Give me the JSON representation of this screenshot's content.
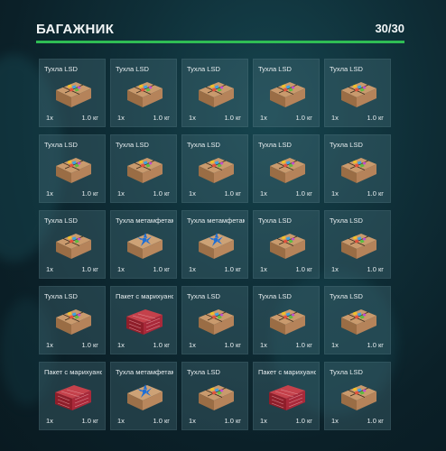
{
  "header": {
    "title": "БАГАЖНИК",
    "capacity": "30/30"
  },
  "colors": {
    "accent": "#2fbd54"
  },
  "slots": [
    {
      "name": "Тухла LSD",
      "qty": "1x",
      "weight": "1.0 кг",
      "icon": "lsd-package-icon"
    },
    {
      "name": "Тухла LSD",
      "qty": "1x",
      "weight": "1.0 кг",
      "icon": "lsd-package-icon"
    },
    {
      "name": "Тухла LSD",
      "qty": "1x",
      "weight": "1.0 кг",
      "icon": "lsd-package-icon"
    },
    {
      "name": "Тухла LSD",
      "qty": "1x",
      "weight": "1.0 кг",
      "icon": "lsd-package-icon"
    },
    {
      "name": "Тухла LSD",
      "qty": "1x",
      "weight": "1.0 кг",
      "icon": "lsd-package-icon"
    },
    {
      "name": "Тухла LSD",
      "qty": "1x",
      "weight": "1.0 кг",
      "icon": "lsd-package-icon"
    },
    {
      "name": "Тухла LSD",
      "qty": "1x",
      "weight": "1.0 кг",
      "icon": "lsd-package-icon"
    },
    {
      "name": "Тухла LSD",
      "qty": "1x",
      "weight": "1.0 кг",
      "icon": "lsd-package-icon"
    },
    {
      "name": "Тухла LSD",
      "qty": "1x",
      "weight": "1.0 кг",
      "icon": "lsd-package-icon"
    },
    {
      "name": "Тухла LSD",
      "qty": "1x",
      "weight": "1.0 кг",
      "icon": "lsd-package-icon"
    },
    {
      "name": "Тухла LSD",
      "qty": "1x",
      "weight": "1.0 кг",
      "icon": "lsd-package-icon"
    },
    {
      "name": "Тухла метамфетамина",
      "qty": "1x",
      "weight": "1.0 кг",
      "icon": "meth-package-icon"
    },
    {
      "name": "Тухла метамфетамина",
      "qty": "1x",
      "weight": "1.0 кг",
      "icon": "meth-package-icon"
    },
    {
      "name": "Тухла LSD",
      "qty": "1x",
      "weight": "1.0 кг",
      "icon": "lsd-package-icon"
    },
    {
      "name": "Тухла LSD",
      "qty": "1x",
      "weight": "1.0 кг",
      "icon": "lsd-package-icon"
    },
    {
      "name": "Тухла LSD",
      "qty": "1x",
      "weight": "1.0 кг",
      "icon": "lsd-package-icon"
    },
    {
      "name": "Пакет с марихуаной",
      "qty": "1x",
      "weight": "1.0 кг",
      "icon": "marijuana-bag-icon"
    },
    {
      "name": "Тухла LSD",
      "qty": "1x",
      "weight": "1.0 кг",
      "icon": "lsd-package-icon"
    },
    {
      "name": "Тухла LSD",
      "qty": "1x",
      "weight": "1.0 кг",
      "icon": "lsd-package-icon"
    },
    {
      "name": "Тухла LSD",
      "qty": "1x",
      "weight": "1.0 кг",
      "icon": "lsd-package-icon"
    },
    {
      "name": "Пакет с марихуаной",
      "qty": "1x",
      "weight": "1.0 кг",
      "icon": "marijuana-bag-icon"
    },
    {
      "name": "Тухла метамфетамина",
      "qty": "1x",
      "weight": "1.0 кг",
      "icon": "meth-package-icon"
    },
    {
      "name": "Тухла LSD",
      "qty": "1x",
      "weight": "1.0 кг",
      "icon": "lsd-package-icon"
    },
    {
      "name": "Пакет с марихуаной",
      "qty": "1x",
      "weight": "1.0 кг",
      "icon": "marijuana-bag-icon"
    },
    {
      "name": "Тухла LSD",
      "qty": "1x",
      "weight": "1.0 кг",
      "icon": "lsd-package-icon"
    }
  ]
}
